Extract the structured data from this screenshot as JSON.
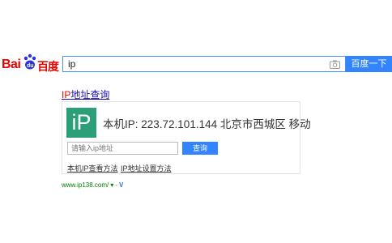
{
  "logo": {
    "bai": "Bai",
    "du": "du",
    "baidu": "百度"
  },
  "search": {
    "value": "ip",
    "button_label": "百度一下"
  },
  "result": {
    "title_ip": "IP",
    "title_rest": "地址查询",
    "ip_badge": "iP",
    "ip_line": "本机IP: 223.72.101.144  北京市西城区 移动",
    "input_placeholder": "请输入ip地址",
    "query_label": "查询",
    "link_view": "本机IP查看方法",
    "link_set": "IP地址设置方法",
    "url": "www.ip138.com/",
    "url_arrow": "▾",
    "url_dash": "-",
    "url_badge": "V"
  }
}
